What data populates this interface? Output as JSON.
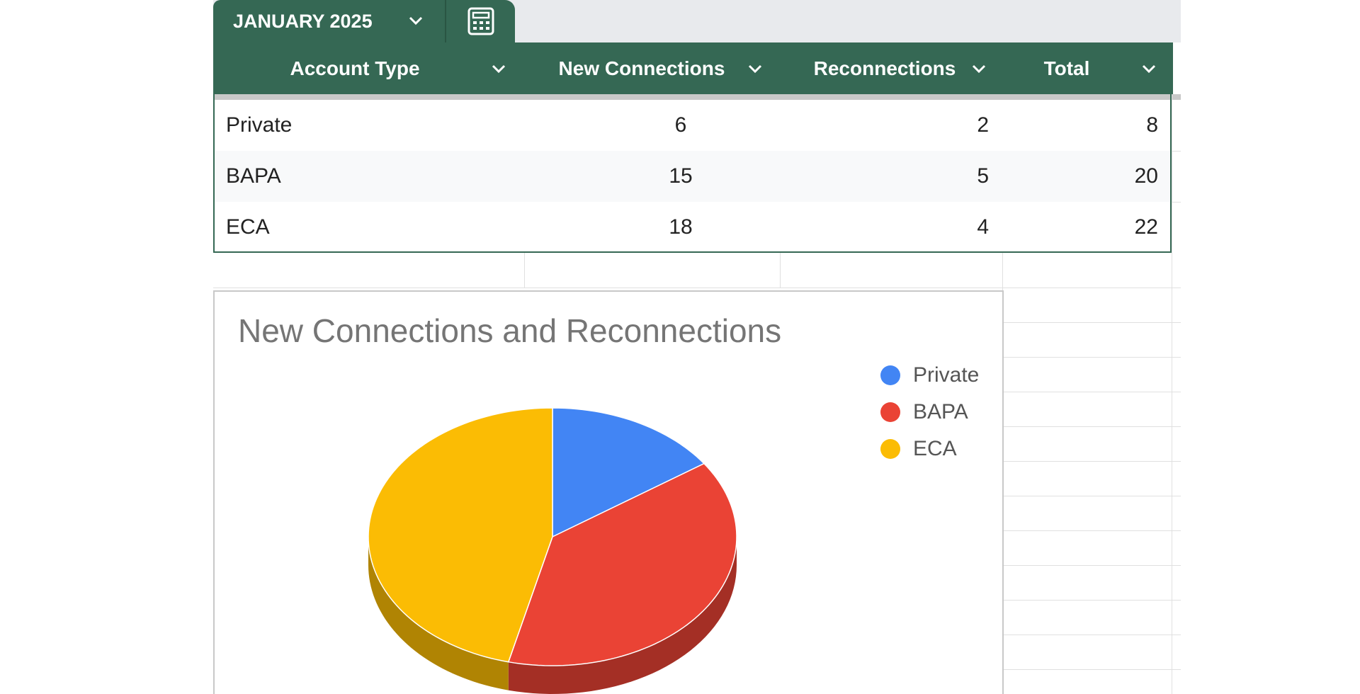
{
  "sheet_tab": {
    "label": "JANUARY 2025",
    "icon": "calculator-icon"
  },
  "table": {
    "headers": [
      "Account Type",
      "New Connections",
      "Reconnections",
      "Total"
    ],
    "rows": [
      [
        "Private",
        "6",
        "2",
        "8"
      ],
      [
        "BAPA",
        "15",
        "5",
        "20"
      ],
      [
        "ECA",
        "18",
        "4",
        "22"
      ]
    ]
  },
  "colors": {
    "header_green": "#356854",
    "private": "#4285f4",
    "bapa": "#ea4335",
    "eca": "#fbbc04"
  },
  "chart_data": {
    "type": "pie",
    "title": "New Connections and Reconnections",
    "legend_position": "right",
    "categories": [
      "Private",
      "BAPA",
      "ECA"
    ],
    "values": [
      6,
      15,
      18
    ],
    "colors": [
      "#4285f4",
      "#ea4335",
      "#fbbc04"
    ],
    "style": "3d"
  }
}
